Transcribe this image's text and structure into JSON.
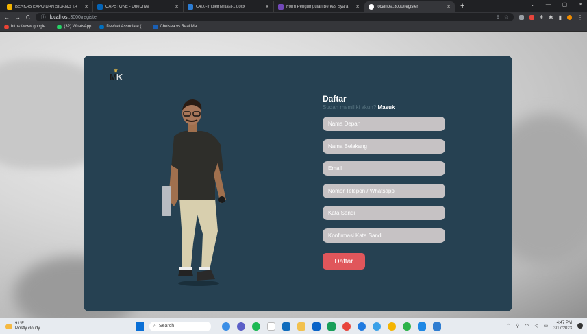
{
  "browser": {
    "tabs": [
      {
        "label": "BERKAS EXPO DAN SIDANG TA",
        "favicon_color": "#f4b400"
      },
      {
        "label": "CAPSTONE - OneDrive",
        "favicon_color": "#0364b8"
      },
      {
        "label": "C400-Implementasi-1.docx",
        "favicon_color": "#2b7cd3"
      },
      {
        "label": "Form Pengumpulan Berkas Syara",
        "favicon_color": "#7248b9"
      },
      {
        "label": "localhost:3000/register",
        "favicon_color": "#ffffff"
      }
    ],
    "new_tab": "+",
    "url_host": "localhost",
    "url_path": ":3000/register",
    "bookmarks": [
      {
        "label": "https://www.google...",
        "color": "#ea4335"
      },
      {
        "label": "(32) WhatsApp",
        "color": "#25d366"
      },
      {
        "label": "DevNet Associate (...",
        "color": "#0070c0"
      },
      {
        "label": "Chelsea vs Real Ma...",
        "color": "#1a5fb4"
      }
    ]
  },
  "logo": {
    "m": "M",
    "k": "K"
  },
  "form": {
    "title": "Daftar",
    "subtitle": "Sudah memiliki akun?",
    "login_link": "Masuk",
    "fields": {
      "first_name": "Nama Depan",
      "last_name": "Nama Belakang",
      "email": "Email",
      "phone": "Nomor Telepon / Whatsapp",
      "password": "Kata Sandi",
      "password_confirm": "Konfirmasi Kata Sandi"
    },
    "submit_label": "Daftar"
  },
  "colors": {
    "card": "#264152",
    "button": "#e0565b",
    "input": "#c6c2c4"
  },
  "taskbar": {
    "temp": "91°F",
    "weather": "Mostly cloudy",
    "search": "Search",
    "time": "4:47 PM",
    "date": "3/17/2023"
  }
}
